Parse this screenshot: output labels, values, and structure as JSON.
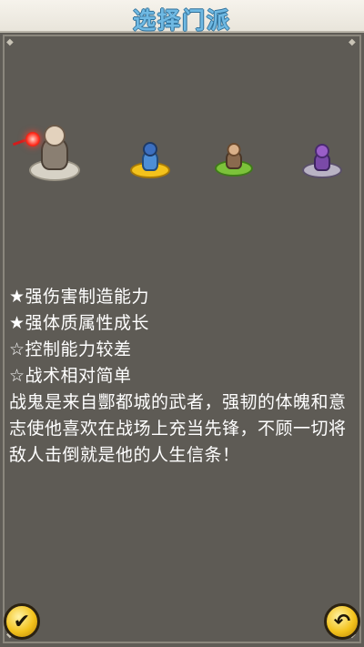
{
  "header": {
    "title": "选择门派"
  },
  "heroes": [
    {
      "name": "战鬼",
      "selected": true
    },
    {
      "name": "hero-2",
      "selected": false
    },
    {
      "name": "hero-3",
      "selected": false
    },
    {
      "name": "hero-4",
      "selected": false
    }
  ],
  "description": {
    "traits": [
      "★强伤害制造能力",
      "★强体质属性成长",
      "☆控制能力较差",
      "☆战术相对简单"
    ],
    "story": "战鬼是来自酆都城的武者，强韧的体魄和意志使他喜欢在战场上充当先锋，不顾一切将敌人击倒就是他的人生信条！"
  },
  "buttons": {
    "confirm_icon": "checkmark-icon",
    "back_icon": "undo-arrow-icon",
    "confirm_glyph": "✔",
    "back_glyph": "↶"
  },
  "colors": {
    "title": "#6fb9e3",
    "panel": "#5e5b55",
    "button": "#f3c21c",
    "selected_glow": "#ff2a1a"
  }
}
